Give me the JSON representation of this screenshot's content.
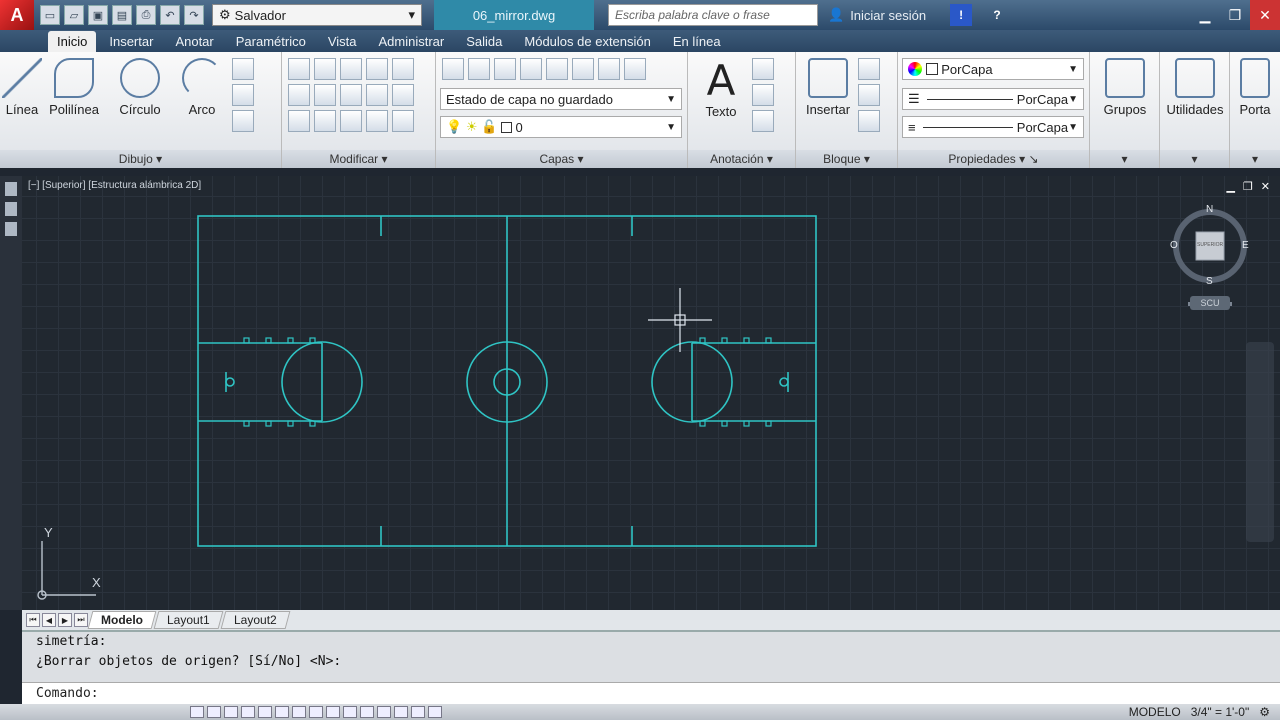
{
  "title_bar": {
    "app_logo": "A",
    "workspace": "Salvador",
    "document_tab": "06_mirror.dwg",
    "search_placeholder": "Escriba palabra clave o frase",
    "signin": "Iniciar sesión",
    "help": "?"
  },
  "ribbon_tabs": [
    "Inicio",
    "Insertar",
    "Anotar",
    "Paramétrico",
    "Vista",
    "Administrar",
    "Salida",
    "Módulos de extensión",
    "En línea"
  ],
  "active_tab": "Inicio",
  "panels": {
    "dibujo": {
      "title": "Dibujo",
      "tools": [
        "Línea",
        "Polilínea",
        "Círculo",
        "Arco"
      ]
    },
    "modificar": {
      "title": "Modificar"
    },
    "capas": {
      "title": "Capas",
      "layer_state": "Estado de capa no guardado",
      "current_layer": "0"
    },
    "anotacion": {
      "title": "Anotación",
      "tool": "Texto"
    },
    "bloque": {
      "title": "Bloque",
      "tool": "Insertar"
    },
    "propiedades": {
      "title": "Propiedades",
      "color": "PorCapa",
      "linetype": "PorCapa",
      "lineweight": "PorCapa"
    },
    "grupos": {
      "tool": "Grupos"
    },
    "utilidades": {
      "tool": "Utilidades"
    },
    "porta": {
      "tool": "Porta"
    }
  },
  "viewport": {
    "label": "[−] [Superior] [Estructura alámbrica 2D]",
    "compass": {
      "n": "N",
      "s": "S",
      "e": "E",
      "w": "O"
    },
    "cube_face": "SUPERIOR",
    "wcs": "SCU",
    "axis_x": "X",
    "axis_y": "Y"
  },
  "layout_tabs": [
    "Modelo",
    "Layout1",
    "Layout2"
  ],
  "command": {
    "history": [
      "simetría:",
      "¿Borrar objetos de origen? [Sí/No] <N>:"
    ],
    "prompt": "Comando:"
  },
  "status": {
    "mode": "MODELO",
    "scale": "3/4\" = 1'-0\""
  },
  "colors": {
    "drawing": "#2fc4c4",
    "background": "#212830",
    "accent": "#2f8aa8"
  }
}
